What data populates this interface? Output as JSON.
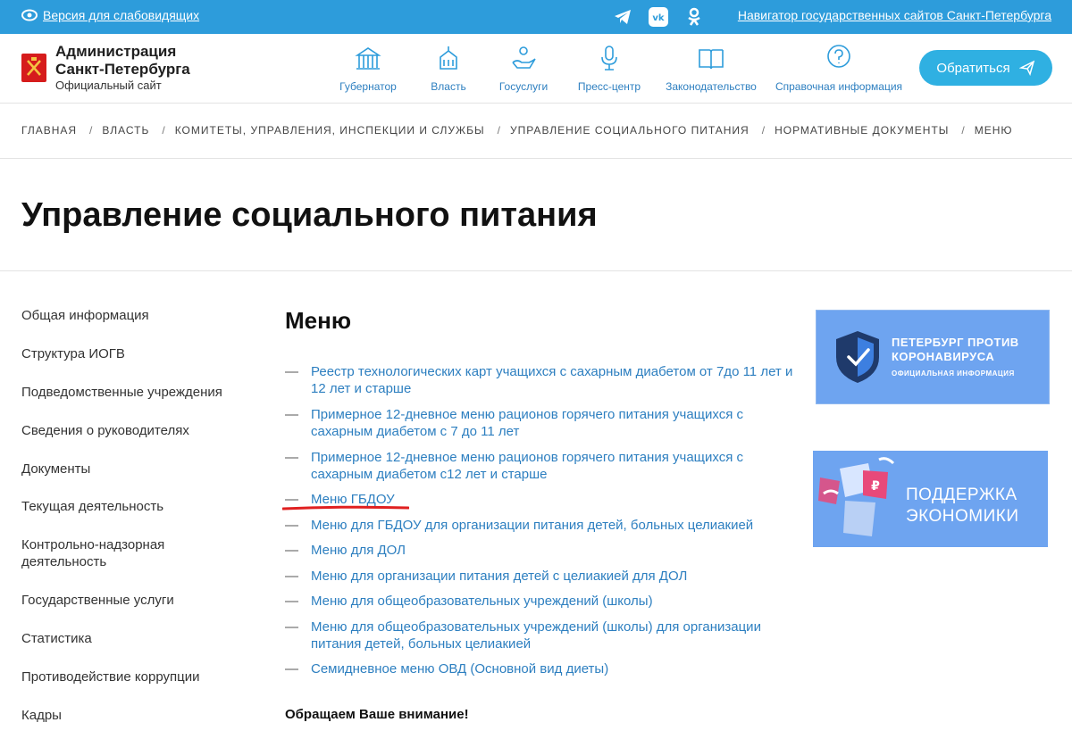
{
  "topbar": {
    "vision_label": "Версия для слабовидящих",
    "navigator_label": "Навигатор государственных сайтов Санкт-Петербурга",
    "bg_color": "#2d9cdb"
  },
  "header": {
    "logo_title_line1": "Администрация",
    "logo_title_line2": "Санкт-Петербурга",
    "logo_subtitle": "Официальный сайт",
    "nav": [
      {
        "label": "Губернатор",
        "icon": "governor-building-icon"
      },
      {
        "label": "Власть",
        "icon": "government-building-icon"
      },
      {
        "label": "Госуслуги",
        "icon": "hand-person-icon"
      },
      {
        "label": "Пресс-центр",
        "icon": "microphone-icon"
      },
      {
        "label": "Законодательство",
        "icon": "book-icon"
      },
      {
        "label": "Справочная информация",
        "icon": "question-icon"
      }
    ],
    "cta_label": "Обратиться",
    "cta_color": "#2fb0e2"
  },
  "breadcrumb": [
    "Главная",
    "Власть",
    "Комитеты, управления, инспекции и службы",
    "Управление социального питания",
    "Нормативные документы",
    "Меню"
  ],
  "page_title": "Управление социального питания",
  "sidebar": [
    "Общая информация",
    "Структура ИОГВ",
    "Подведомственные учреждения",
    "Сведения о руководителях",
    "Документы",
    "Текущая деятельность",
    "Контрольно-надзорная деятельность",
    "Государственные услуги",
    "Статистика",
    "Противодействие коррупции",
    "Кадры"
  ],
  "content": {
    "title": "Меню",
    "dash": "—",
    "items": [
      "Реестр технологических карт учащихся с сахарным диабетом от 7до 11 лет и 12 лет и старше",
      "Примерное 12-дневное меню рационов горячего питания учащихся с сахарным диабетом с 7 до 11 лет",
      "Примерное 12-дневное меню рационов горячего питания учащихся с сахарным диабетом с12 лет и старше",
      "Меню ГБДОУ",
      "Меню для ГБДОУ для организации питания детей, больных целиакией",
      "Меню для ДОЛ",
      "Меню для организации питания детей с целиакией для ДОЛ",
      "Меню для общеобразовательных учреждений (школы)",
      "Меню для общеобразовательных учреждений (школы) для организации питания детей, больных целиакией",
      "Семидневное меню ОВД (Основной вид диеты)"
    ],
    "notice": "Обращаем Ваше внимание!",
    "link_color": "#2d7fc0",
    "annotation_color": "#e02020"
  },
  "banners": {
    "covid_title": "ПЕТЕРБУРГ ПРОТИВ КОРОНАВИРУСА",
    "covid_sub": "ОФИЦИАЛЬНАЯ ИНФОРМАЦИЯ",
    "economy_line1": "ПОДДЕРЖКА",
    "economy_line2": "ЭКОНОМИКИ",
    "banner_color": "#6ea4f0"
  }
}
